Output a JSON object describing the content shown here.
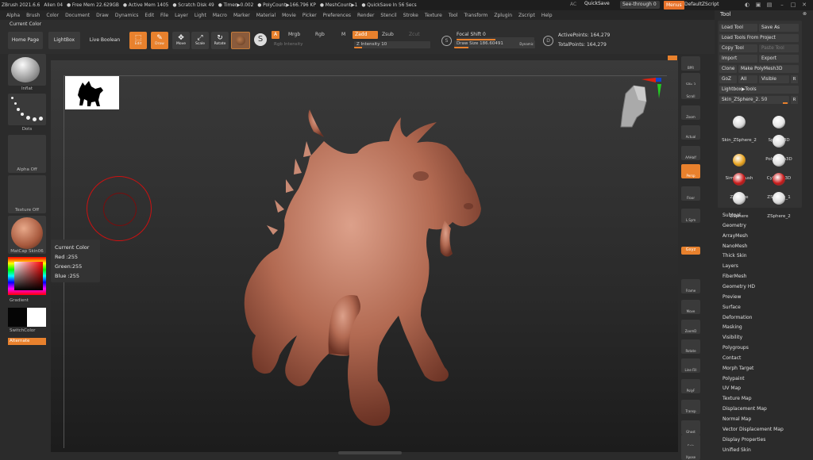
{
  "titlebar": {
    "items": [
      "ZBrush 2021.6.6",
      "Alien 04",
      "● Free Mem 22.629GB",
      "● Active Mem 1405",
      "● Scratch Disk 49",
      "● Timer▶0.002",
      "● PolyCount▶166.796 KP",
      "● MeshCount▶1",
      "● QuickSave In 56 Secs"
    ],
    "ac": "AC",
    "quicksave": "QuickSave",
    "see_through": "See-through  0",
    "menus": "Menus",
    "default_zscript": "DefaultZScript"
  },
  "menubar": [
    "Alpha",
    "Brush",
    "Color",
    "Document",
    "Draw",
    "Dynamics",
    "Edit",
    "File",
    "Layer",
    "Light",
    "Macro",
    "Marker",
    "Material",
    "Movie",
    "Picker",
    "Preferences",
    "Render",
    "Stencil",
    "Stroke",
    "Texture",
    "Tool",
    "Transform",
    "Zplugin",
    "Zscript",
    "Help"
  ],
  "shelf": {
    "current_color": "Current Color",
    "home_page": "Home Page",
    "lightbox": "LightBox",
    "live_boolean": "Live Boolean",
    "edit": "Edit",
    "draw": "Draw",
    "move": "Move",
    "scale": "Scale",
    "rotate": "Rotate",
    "a_toggle": "A",
    "mrgb": "Mrgb",
    "rgb": "Rgb",
    "m": "M",
    "zadd": "Zadd",
    "zsub": "Zsub",
    "zcut": "Zcut",
    "rgb_intensity": "Rgb Intensity",
    "z_intensity": "Z Intensity 10",
    "z_intensity_value": 0.1,
    "focal_shift": "Focal Shift 0",
    "focal_shift_value": 0.5,
    "draw_size": "Draw Size 186.60491",
    "draw_size_value": 0.18,
    "dynamic": "Dynamic",
    "active_points": "ActivePoints: 164,279",
    "total_points": "TotalPoints: 164,279"
  },
  "left": {
    "brush_label": "Inflat",
    "stroke_label": "Dots",
    "alpha_label": "Alpha Off",
    "texture_label": "Texture Off",
    "material_label": "MatCap Skin06",
    "gradient_label": "Gradient",
    "switch_color": "SwitchColor",
    "alternate": "Alternate"
  },
  "color_tooltip": {
    "title": "Current Color",
    "red": "Red :255",
    "green": "Green:255",
    "blue": "Blue :255"
  },
  "rightbar": [
    "BPR",
    "SPix 3",
    "Scroll",
    "Zoom",
    "Actual",
    "AAHalf",
    "Persp",
    "Floor",
    "L.Sym",
    "Gxyz",
    "Frame",
    "Move",
    "ZoomD",
    "Rotate",
    "Line Fill",
    "PolyF",
    "Transp",
    "Ghost",
    "Solo",
    "Xpose"
  ],
  "tool": {
    "title": "Tool",
    "load_tool": "Load Tool",
    "save_as": "Save As",
    "load_from_project": "Load Tools From Project",
    "copy_tool": "Copy Tool",
    "paste_tool": "Paste Tool",
    "import": "Import",
    "export": "Export",
    "clone": "Clone",
    "make_polymesh": "Make PolyMesh3D",
    "goz": "GoZ",
    "all": "All",
    "visible": "Visible",
    "r": "R",
    "lightbox_tools": "Lightbox▶Tools",
    "current_tool_slider": "Skin_ZSphere_2. 50",
    "thumbs": [
      "Skin_ZSphere_2",
      "Sphere3D",
      "",
      "PolyMesh3D",
      "SimpleBrush",
      "Cylinder3D",
      "ZSphere",
      "ZSphere_1",
      "ZSphere",
      "ZSphere_2"
    ],
    "subpalettes": [
      "Subtool",
      "Geometry",
      "ArrayMesh",
      "NanoMesh",
      "Thick Skin",
      "Layers",
      "FiberMesh",
      "Geometry HD",
      "Preview",
      "Surface",
      "Deformation",
      "Masking",
      "Visibility",
      "Polygroups",
      "Contact",
      "Morph Target",
      "Polypaint",
      "UV Map",
      "Texture Map",
      "Displacement Map",
      "Normal Map",
      "Vector Displacement Map",
      "Display Properties",
      "Unified Skin"
    ]
  },
  "colors": {
    "accent": "#e8812d",
    "model": "#b86c55"
  }
}
